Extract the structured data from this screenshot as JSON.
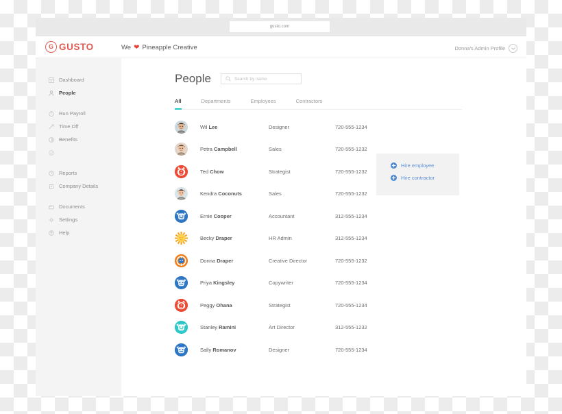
{
  "browser": {
    "url": "gusto.com"
  },
  "appbar": {
    "logo_mark": "G",
    "logo_word": "GUSTO",
    "company_prefix": "We",
    "heart_icon": "heart-icon",
    "company_name": "Pineapple Creative",
    "profile_label": "Donna's Admin Profile",
    "profile_chevron": "chevron-down-icon"
  },
  "sidebar": {
    "groups": [
      {
        "items": [
          {
            "label": "Dashboard",
            "icon": "dashboard-icon",
            "active": false
          },
          {
            "label": "People",
            "icon": "person-icon",
            "active": true
          }
        ]
      },
      {
        "items": [
          {
            "label": "Run Payroll",
            "icon": "payroll-icon",
            "active": false
          },
          {
            "label": "Time Off",
            "icon": "time-off-icon",
            "active": false
          },
          {
            "label": "Benefits",
            "icon": "benefits-icon",
            "active": false
          },
          {
            "label": "",
            "icon": "check-circle-icon",
            "active": false
          }
        ]
      },
      {
        "items": [
          {
            "label": "Reports",
            "icon": "reports-icon",
            "active": false
          },
          {
            "label": "Company Details",
            "icon": "company-icon",
            "active": false
          }
        ]
      },
      {
        "items": [
          {
            "label": "Documents",
            "icon": "documents-icon",
            "active": false
          },
          {
            "label": "Settings",
            "icon": "gear-icon",
            "active": false
          },
          {
            "label": "Help",
            "icon": "help-icon",
            "active": false
          }
        ]
      }
    ]
  },
  "main": {
    "title": "People",
    "search": {
      "placeholder": "Search by name",
      "value": "",
      "icon": "search-icon"
    },
    "tabs": [
      {
        "label": "All",
        "active": true
      },
      {
        "label": "Departments",
        "active": false
      },
      {
        "label": "Employees",
        "active": false
      },
      {
        "label": "Contractors",
        "active": false
      }
    ],
    "people": [
      {
        "first": "Wil",
        "last": "Lee",
        "role": "Designer",
        "phone": "720-555-1234",
        "avatar": "photo-man",
        "color": "#dfe6e8"
      },
      {
        "first": "Petra",
        "last": "Campbell",
        "role": "Sales",
        "phone": "720-555-1232",
        "avatar": "photo-woman",
        "color": "#e8ddd3"
      },
      {
        "first": "Ted",
        "last": "Chow",
        "role": "Strategist",
        "phone": "720-555-1232",
        "avatar": "fox-character",
        "color": "#ed4b35"
      },
      {
        "first": "Kendra",
        "last": "Coconuts",
        "role": "Sales",
        "phone": "720-555-1232",
        "avatar": "photo-woman-2",
        "color": "#dde7ea"
      },
      {
        "first": "Ernie",
        "last": "Cooper",
        "role": "Accountant",
        "phone": "312-555-1234",
        "avatar": "robot-character",
        "color": "#2f76c4"
      },
      {
        "first": "Becky",
        "last": "Draper",
        "role": "HR Admin",
        "phone": "312-555-1234",
        "avatar": "sun-character",
        "color": "#f5a623"
      },
      {
        "first": "Donna",
        "last": "Draper",
        "role": "Creative Director",
        "phone": "720-555-1232",
        "avatar": "orange-character",
        "color": "#f07d1a"
      },
      {
        "first": "Priya",
        "last": "Kingsley",
        "role": "Copywriter",
        "phone": "720-555-1234",
        "avatar": "cat-character",
        "color": "#2f76c4"
      },
      {
        "first": "Peggy",
        "last": "Ohana",
        "role": "Strategist",
        "phone": "720-555-1234",
        "avatar": "fox-character-2",
        "color": "#ed4b35"
      },
      {
        "first": "Stanley",
        "last": "Ramini",
        "role": "Art Director",
        "phone": "312-555-1232",
        "avatar": "teal-robot",
        "color": "#2ec8c8"
      },
      {
        "first": "Sally",
        "last": "Romanov",
        "role": "Designer",
        "phone": "720-555-1234",
        "avatar": "blue-monster",
        "color": "#2f76c4"
      }
    ],
    "hire_panel": {
      "employee_label": "Hire employee",
      "contractor_label": "Hire contractor",
      "icon": "plus-circle-icon"
    }
  },
  "colors": {
    "brand_red": "#e05a52",
    "accent_teal": "#1fc8c0",
    "link_blue": "#5a8fd8",
    "sidebar_bg": "#f4f4f4"
  }
}
